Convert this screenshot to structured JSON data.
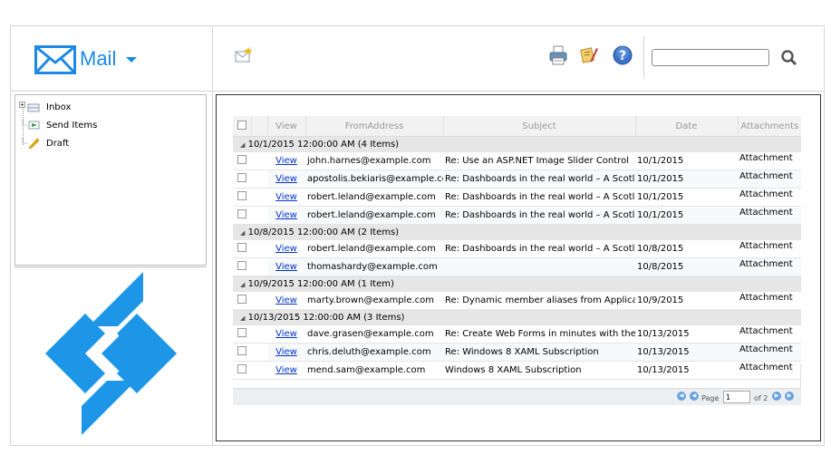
{
  "header": {
    "app_label": "Mail",
    "search": {
      "value": ""
    }
  },
  "toolbar": {
    "icons": [
      "compose-icon",
      "print-icon",
      "edit-icon",
      "help-icon",
      "search-icon"
    ]
  },
  "tree": {
    "items": [
      {
        "label": "Inbox",
        "icon": "inbox-icon"
      },
      {
        "label": "Send Items",
        "icon": "send-icon"
      },
      {
        "label": "Draft",
        "icon": "draft-icon"
      }
    ]
  },
  "grid": {
    "columns": [
      "View",
      "FromAddress",
      "Subject",
      "Date",
      "Attachments"
    ],
    "groups": [
      {
        "label": "10/1/2015 12:00:00 AM (4 Items)",
        "rows": [
          {
            "view": "View",
            "from": "john.harnes@example.com",
            "subject": "Re: Use an ASP.NET Image Slider Control",
            "date": "10/1/2015",
            "attachment": "Attachment"
          },
          {
            "view": "View",
            "from": "apostolis.bekiaris@example.com",
            "subject": "Re: Dashboards in the real world – A Scotland",
            "date": "10/1/2015",
            "attachment": "Attachment"
          },
          {
            "view": "View",
            "from": "robert.leland@example.com",
            "subject": "Re: Dashboards in the real world – A Scotland",
            "date": "10/1/2015",
            "attachment": "Attachment"
          },
          {
            "view": "View",
            "from": "robert.leland@example.com",
            "subject": "Re: Dashboards in the real world – A Scotland",
            "date": "10/1/2015",
            "attachment": "Attachment"
          }
        ]
      },
      {
        "label": "10/8/2015 12:00:00 AM (2 Items)",
        "rows": [
          {
            "view": "View",
            "from": "robert.leland@example.com",
            "subject": "Re: Dashboards in the real world – A Scotland",
            "date": "10/8/2015",
            "attachment": "Attachment"
          },
          {
            "view": "View",
            "from": "thomashardy@example.com",
            "subject": "",
            "date": "10/8/2015",
            "attachment": "Attachment"
          }
        ]
      },
      {
        "label": "10/9/2015 12:00:00 AM (1 Item)",
        "rows": [
          {
            "view": "View",
            "from": "marty.brown@example.com",
            "subject": "Re: Dynamic member aliases from Application",
            "date": "10/9/2015",
            "attachment": "Attachment"
          }
        ]
      },
      {
        "label": "10/13/2015 12:00:00 AM (3 Items)",
        "rows": [
          {
            "view": "View",
            "from": "dave.grasen@example.com",
            "subject": "Re: Create Web Forms in minutes with the",
            "date": "10/13/2015",
            "attachment": "Attachment"
          },
          {
            "view": "View",
            "from": "chris.deluth@example.com",
            "subject": "Re: Windows 8 XAML Subscription",
            "date": "10/13/2015",
            "attachment": "Attachment"
          },
          {
            "view": "View",
            "from": "mend.sam@example.com",
            "subject": "Windows 8 XAML Subscription",
            "date": "10/13/2015",
            "attachment": "Attachment"
          }
        ]
      }
    ]
  },
  "pager": {
    "page_label": "Page",
    "current": "1",
    "of_label": "of 2"
  },
  "colors": {
    "brand": "#1e88e5",
    "group_bg": "#e6e6e6",
    "link": "#0033cc"
  }
}
